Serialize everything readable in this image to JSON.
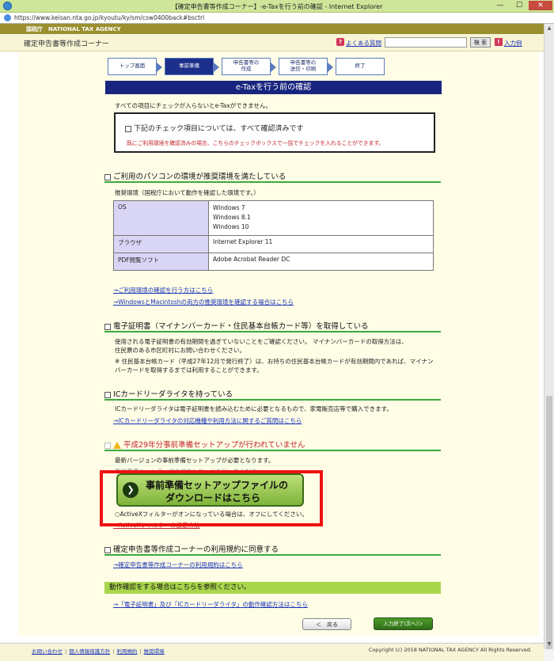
{
  "window": {
    "title": "【確定申告書等作成コーナー】-e-Taxを行う前の確認 - Internet Explorer",
    "url": "https://www.keisan.nta.go.jp/kyoutu/ky/sm/csw0400back#bsctrl",
    "min": "—",
    "max": "☐",
    "close": "✕"
  },
  "header": {
    "agency": "国税庁　NATIONAL TAX AGENCY",
    "corner_name": "確定申告書等作成コーナー",
    "faq_icon": "?",
    "faq": "よくある質問",
    "search_button": "検 索",
    "example_icon": "!",
    "example": "入力例"
  },
  "steps": [
    {
      "label": "トップ画面"
    },
    {
      "label": "事前準備"
    },
    {
      "label": "申告書等の\n作成"
    },
    {
      "label": "申告書等の\n送信・印刷"
    },
    {
      "label": "終了"
    }
  ],
  "page_title": "e-Taxを行う前の確認",
  "intro": "すべての項目にチェックが入らないとe-Taxができません。",
  "check_all": {
    "label": "下記のチェック項目については、すべて確認済みです",
    "hint": "既にご利用環境を確認済みの場合、こちらのチェックボックスで一括でチェックを入れることができます。"
  },
  "section_env": {
    "heading": "ご利用のパソコンの環境が推奨環境を満たしている",
    "desc": "推奨環境（国税庁において動作を確認した環境です。）",
    "table": [
      {
        "k": "OS",
        "v1": "Windows 7",
        "v2": "Windows 8.1",
        "v3": "Windows 10"
      },
      {
        "k": "ブラウザ",
        "v1": "Internet Explorer 11"
      },
      {
        "k": "PDF閲覧ソフト",
        "v1": "Adobe Acrobat Reader DC"
      }
    ],
    "link1": "→ご利用環境の確認を行う方はこちら",
    "link2": "→WindowsとMacintoshの両方の推奨環境を確認する場合はこちら"
  },
  "section_cert": {
    "heading": "電子証明書（マイナンバーカード・住民基本台帳カード等）を取得している",
    "p1a": "使用される電子証明書の有効期間を過ぎていないことをご確認ください。 マイナンバーカードの取得方法は、",
    "p1b": "住民票のある市区町村にお問い合わせください。",
    "p2a": "※ 住民基本台帳カード（平成27年12月で発行終了）は、お持ちの住民基本台帳カードが有効期間内であれば、マイナン",
    "p2b": "バーカードを取得するまでは利用することができます。"
  },
  "section_ic": {
    "heading": "ICカードリーダライタを持っている",
    "desc": "ICカードリーダライタは電子証明書を読み込むために必要となるもので、家電販売店等で購入できます。",
    "link": "→ICカードリーダライタの対応機種や利用方法に関するご質問はこちら"
  },
  "section_setup": {
    "heading": "平成29年分事前準備セットアップが行われていません",
    "desc": "最新バージョンの事前準備セットアップが必要となります。",
    "desc2": "事前準備セットアップのダウンロードを行ってください。",
    "button_l1": "事前準備セットアップファイルの",
    "button_l2": "ダウンロードはこちら",
    "button_icon": "❯",
    "note": "○ActiveXフィルターがオンになっている場合は、オフにしてください。",
    "note_link": "→ActiveXフィルターの設定方法"
  },
  "section_terms": {
    "heading": "確定申告書等作成コーナーの利用規約に同意する",
    "link": "→確定申告書等作成コーナーの利用規約はこちら"
  },
  "check_bar": {
    "text": "動作確認をする場合はこちらを参照ください。",
    "link": "→「電子証明書」及び「ICカードリーダライタ」の動作確認方法はこちら"
  },
  "nav": {
    "back": "＜　戻る",
    "next": "入力終了(次へ)＞"
  },
  "footer": {
    "links": [
      "お問い合わせ",
      "個人情報保護方針",
      "利用規約",
      "推奨環境"
    ],
    "copyright": "Copyright (c) 2018 NATIONAL TAX AGENCY All Rights Reserved."
  }
}
